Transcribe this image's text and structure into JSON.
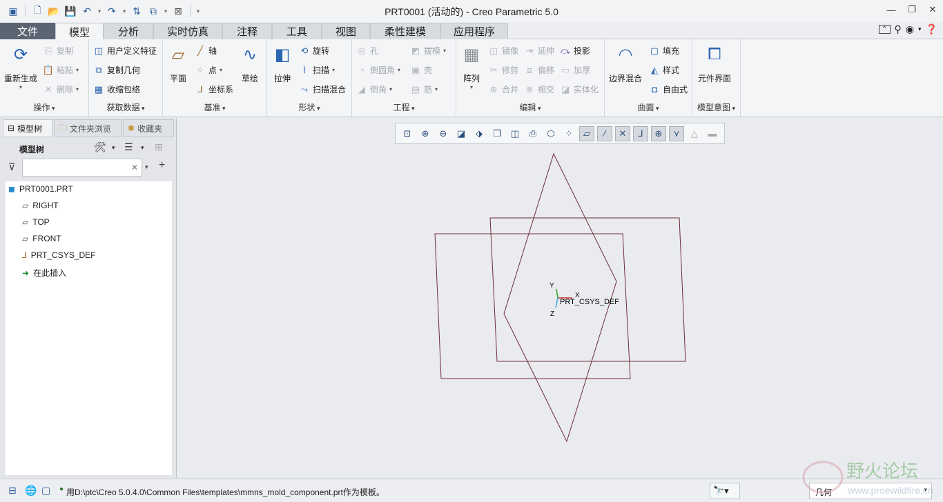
{
  "window": {
    "title": "PRT0001 (活动的) - Creo Parametric 5.0"
  },
  "quick_access": {
    "icons": [
      "new-icon",
      "open-icon",
      "save-icon",
      "undo-icon",
      "redo-icon",
      "regenerate-icon",
      "windows-icon",
      "close-icon",
      "customize-icon"
    ]
  },
  "tabs": [
    {
      "label": "文件"
    },
    {
      "label": "模型"
    },
    {
      "label": "分析"
    },
    {
      "label": "实时仿真"
    },
    {
      "label": "注释"
    },
    {
      "label": "工具"
    },
    {
      "label": "视图"
    },
    {
      "label": "柔性建模"
    },
    {
      "label": "应用程序"
    }
  ],
  "active_tab": "模型",
  "ribbon": {
    "operations": {
      "label": "操作",
      "regenerate": "重新生成",
      "copy": "复制",
      "paste": "粘贴",
      "delete": "删除"
    },
    "get_data": {
      "label": "获取数据",
      "udf": "用户定义特征",
      "copy_geom": "复制几何",
      "shrinkwrap": "收缩包络"
    },
    "datum": {
      "label": "基准",
      "plane": "平面",
      "axis": "轴",
      "point": "点",
      "csys": "坐标系",
      "sketch": "草绘"
    },
    "shapes": {
      "label": "形状",
      "extrude": "拉伸",
      "revolve": "旋转",
      "sweep": "扫描",
      "swept_blend": "扫描混合"
    },
    "engineering": {
      "label": "工程",
      "hole": "孔",
      "draft": "拔模",
      "round": "倒圆角",
      "shell": "壳",
      "chamfer": "倒角",
      "rib": "筋"
    },
    "editing": {
      "label": "编辑",
      "pattern": "阵列",
      "mirror": "镜像",
      "extend": "延伸",
      "project": "投影",
      "trim": "修剪",
      "offset": "偏移",
      "thicken": "加厚",
      "merge": "合并",
      "intersect": "相交",
      "solidify": "实体化"
    },
    "surfaces": {
      "label": "曲面",
      "boundary_blend": "边界混合",
      "fill": "填充",
      "style": "样式",
      "freestyle": "自由式"
    },
    "model_intent": {
      "label": "模型意图",
      "component_interface": "元件界面"
    }
  },
  "panel": {
    "tabs": [
      "模型树",
      "文件夹浏览",
      "收藏夹"
    ],
    "header": "模型树",
    "search_placeholder": "",
    "tree": [
      {
        "label": "PRT0001.PRT",
        "icon": "part-icon"
      },
      {
        "label": "RIGHT",
        "icon": "datum-plane-icon"
      },
      {
        "label": "TOP",
        "icon": "datum-plane-icon"
      },
      {
        "label": "FRONT",
        "icon": "datum-plane-icon"
      },
      {
        "label": "PRT_CSYS_DEF",
        "icon": "csys-icon"
      },
      {
        "label": "在此插入",
        "icon": "insert-here-icon"
      }
    ]
  },
  "graphics": {
    "csys_label": "PRT_CSYS_DEF",
    "axis_labels": {
      "x": "X",
      "y": "Y",
      "z": "Z"
    },
    "plane_color": "#6e2b3a"
  },
  "status": {
    "message": "用D:\\ptc\\Creo 5.0.4.0\\Common Files\\templates\\mmns_mold_component.prt作为模板。",
    "filter": "几何"
  },
  "watermark": {
    "text": "野火论坛",
    "url": "www.proewildfire.cn"
  }
}
